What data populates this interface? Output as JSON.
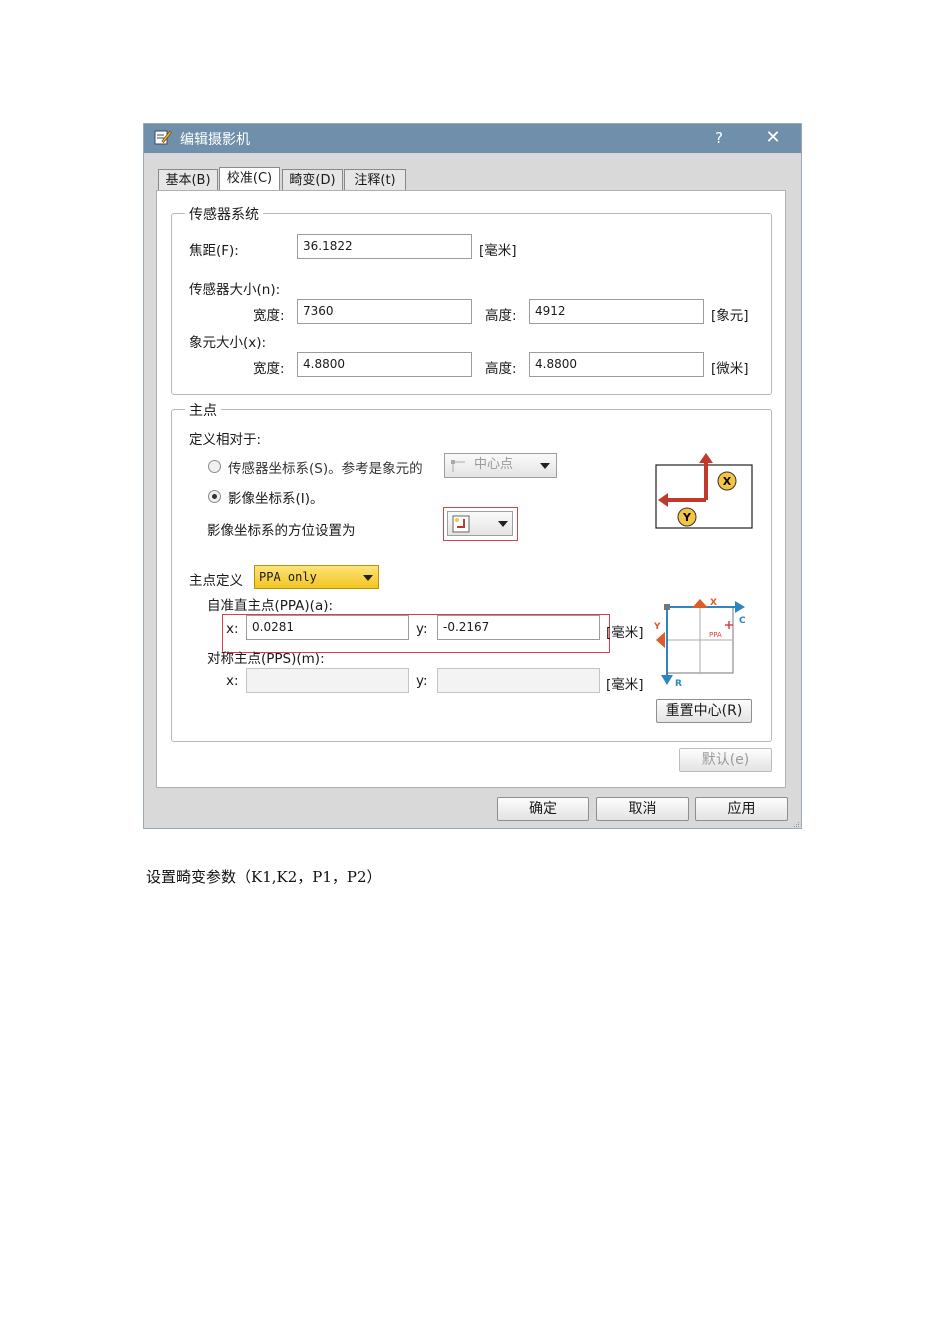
{
  "window": {
    "title": "编辑摄影机",
    "help_label": "?",
    "close_label": "✕"
  },
  "tabs": [
    {
      "label": "基本(B)",
      "active": false
    },
    {
      "label": "校准(C)",
      "active": true
    },
    {
      "label": "畸变(D)",
      "active": false
    },
    {
      "label": "注释(t)",
      "active": false
    }
  ],
  "sensor": {
    "group_title": "传感器系统",
    "focal_label": "焦距(F):",
    "focal_value": "36.1822",
    "focal_unit": "[毫米]",
    "size_label": "传感器大小(n):",
    "width_label": "宽度:",
    "width_value": "7360",
    "height_label": "高度:",
    "height_value": "4912",
    "size_unit": "[象元]",
    "pixel_label": "象元大小(x):",
    "pixel_width_label": "宽度:",
    "pixel_width_value": "4.8800",
    "pixel_height_label": "高度:",
    "pixel_height_value": "4.8800",
    "pixel_unit": "[微米]"
  },
  "principal": {
    "group_title": "主点",
    "relative_label": "定义相对于:",
    "radio_sensor_label": "传感器坐标系(S)。参考是象元的",
    "radio_sensor_selected": false,
    "ref_combo_value": "中心点",
    "radio_image_label": "影像坐标系(I)。",
    "radio_image_selected": true,
    "orientation_label": "影像坐标系的方位设置为",
    "def_label": "主点定义",
    "def_value": "PPA only",
    "ppa_label": "自准直主点(PPA)(a):",
    "ppa_x_label": "x:",
    "ppa_x_value": "0.0281",
    "ppa_y_label": "y:",
    "ppa_y_value": "-0.2167",
    "ppa_unit": "[毫米]",
    "pps_label": "对称主点(PPS)(m):",
    "pps_x_label": "x:",
    "pps_x_value": "",
    "pps_y_label": "y:",
    "pps_y_value": "",
    "pps_unit": "[毫米]",
    "reset_label": "重置中心(R)",
    "diagram_x_label": "X",
    "diagram_y_label": "Y",
    "diagram2_x_label": "X",
    "diagram2_y_label": "Y",
    "diagram2_c_label": "C",
    "diagram2_r_label": "R",
    "diagram2_ppa_label": "PPA"
  },
  "default_label": "默认(e)",
  "footer": {
    "ok_label": "确定",
    "cancel_label": "取消",
    "apply_label": "应用"
  },
  "caption": "设置畸变参数（K1,K2，P1，P2）",
  "colors": {
    "titlebar": "#6f8fab",
    "combo_highlight": "#f7d033",
    "red_highlight": "#d9424a",
    "arrow_red": "#c0392b",
    "arrow_blue": "#2e86c1",
    "badge_yellow": "#f4c542"
  }
}
